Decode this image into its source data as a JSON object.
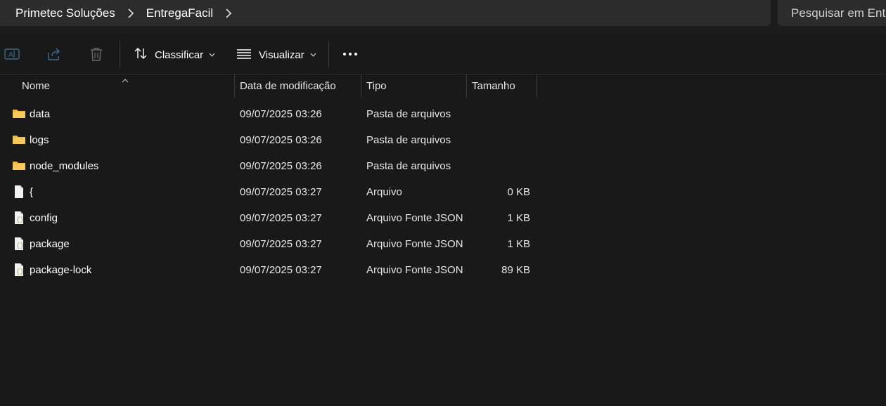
{
  "breadcrumb": [
    "Primetec Soluções",
    "EntregaFacil"
  ],
  "search": {
    "placeholder": "Pesquisar em EntregaFacil"
  },
  "toolbar": {
    "sort_label": "Classificar",
    "view_label": "Visualizar"
  },
  "columns": {
    "name": "Nome",
    "date": "Data de modificação",
    "type": "Tipo",
    "size": "Tamanho"
  },
  "files": [
    {
      "name": "data",
      "date": "09/07/2025 03:26",
      "type": "Pasta de arquivos",
      "size": "",
      "icon": "folder-icon"
    },
    {
      "name": "logs",
      "date": "09/07/2025 03:26",
      "type": "Pasta de arquivos",
      "size": "",
      "icon": "folder-icon"
    },
    {
      "name": "node_modules",
      "date": "09/07/2025 03:26",
      "type": "Pasta de arquivos",
      "size": "",
      "icon": "folder-icon"
    },
    {
      "name": "{",
      "date": "09/07/2025 03:27",
      "type": "Arquivo",
      "size": "0 KB",
      "icon": "file-icon"
    },
    {
      "name": "config",
      "date": "09/07/2025 03:27",
      "type": "Arquivo Fonte JSON",
      "size": "1 KB",
      "icon": "json-file-icon"
    },
    {
      "name": "package",
      "date": "09/07/2025 03:27",
      "type": "Arquivo Fonte JSON",
      "size": "1 KB",
      "icon": "json-file-icon"
    },
    {
      "name": "package-lock",
      "date": "09/07/2025 03:27",
      "type": "Arquivo Fonte JSON",
      "size": "89 KB",
      "icon": "json-file-icon"
    }
  ],
  "colors": {
    "background": "#191919",
    "address_bar": "#2c2c2c",
    "folder": "#f5c04a"
  }
}
